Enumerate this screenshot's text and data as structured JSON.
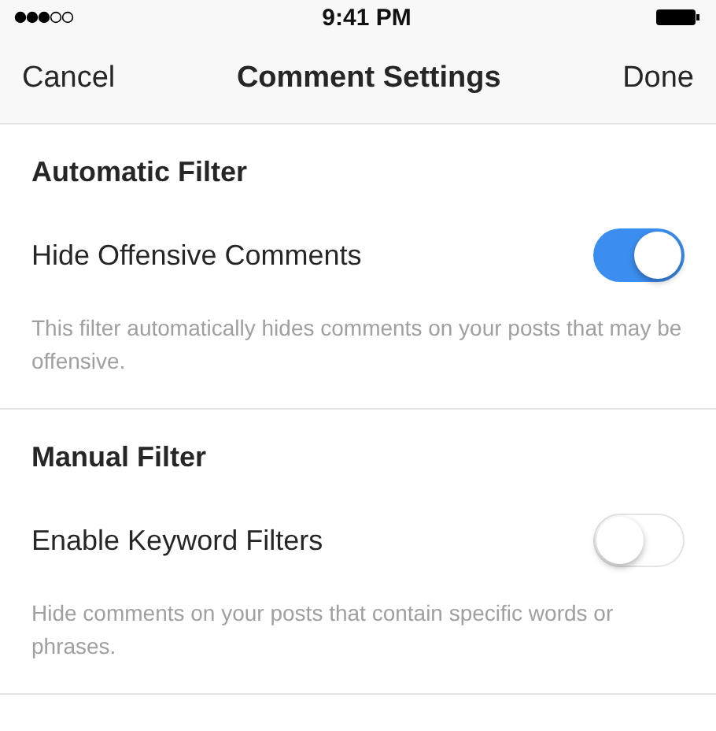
{
  "status_bar": {
    "time": "9:41 PM"
  },
  "nav": {
    "cancel": "Cancel",
    "title": "Comment Settings",
    "done": "Done"
  },
  "sections": [
    {
      "heading": "Automatic Filter",
      "setting": {
        "label": "Hide Offensive Comments",
        "on": true
      },
      "description": "This filter automatically hides comments on your posts that may be offensive."
    },
    {
      "heading": "Manual Filter",
      "setting": {
        "label": "Enable Keyword Filters",
        "on": false
      },
      "description": "Hide comments on your posts that contain specific words or phrases."
    }
  ]
}
